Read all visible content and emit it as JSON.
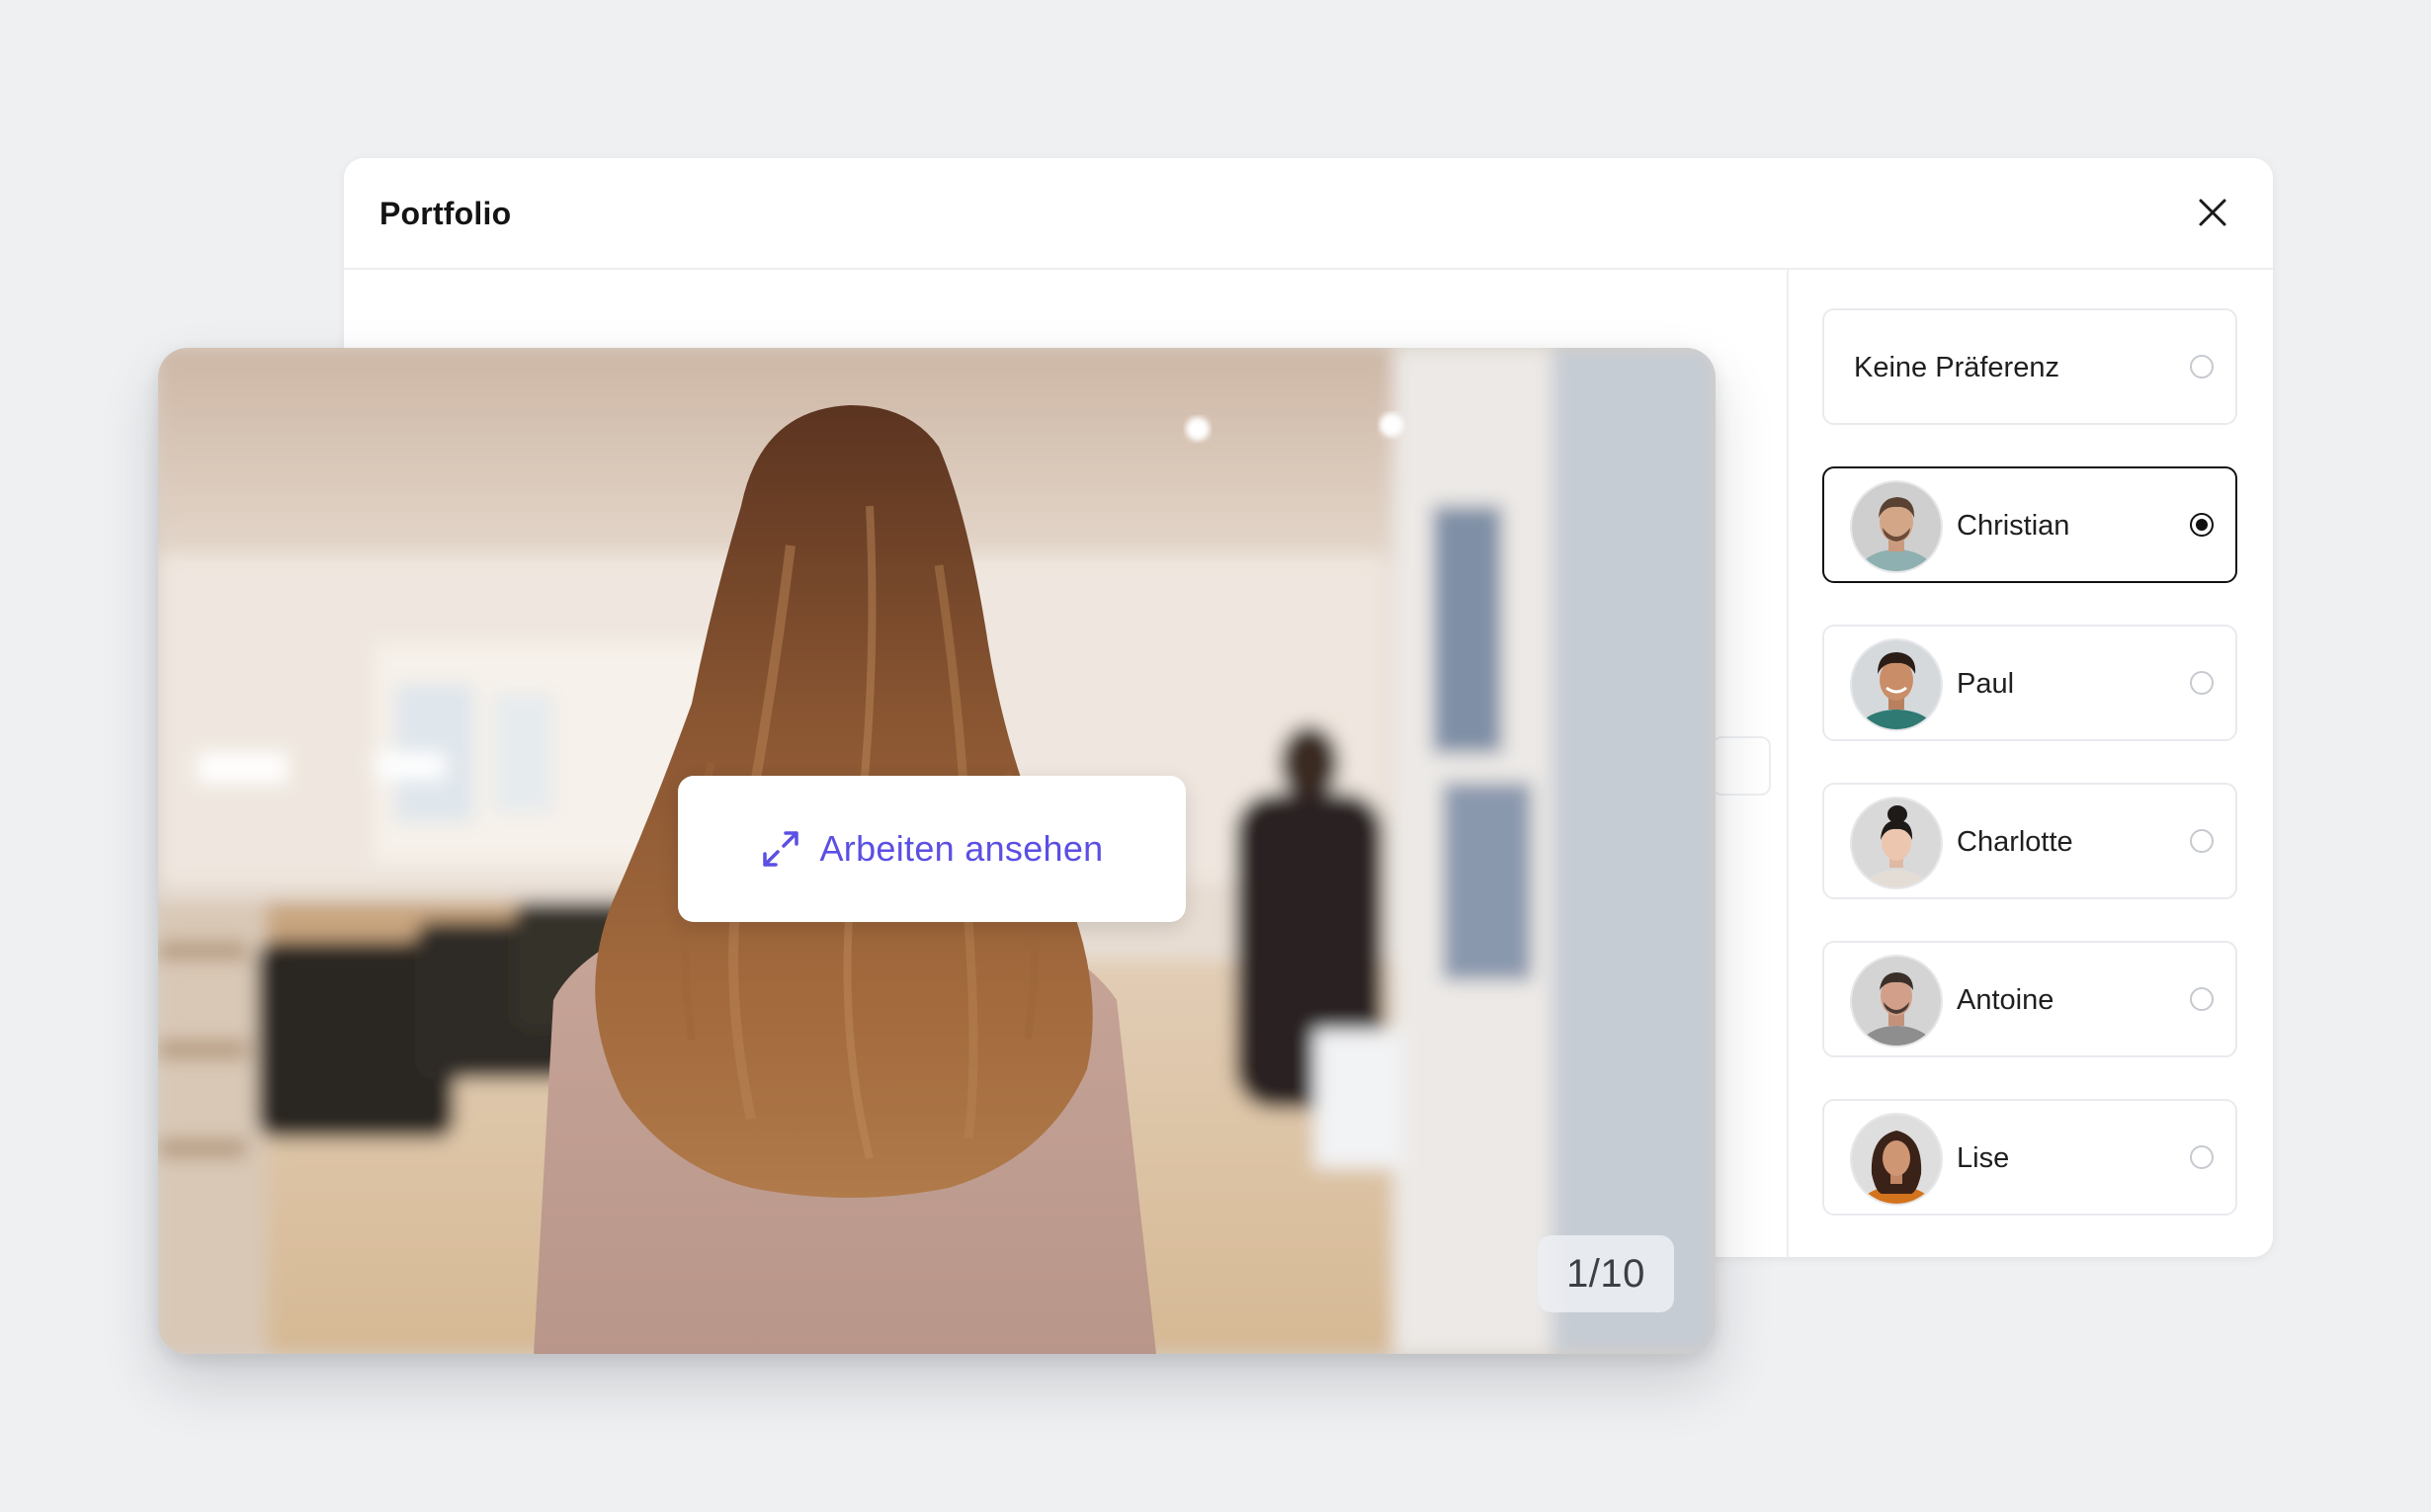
{
  "modal": {
    "title": "Portfolio"
  },
  "photo": {
    "action_label": "Arbeiten ansehen",
    "counter": "1/10"
  },
  "stylists": [
    {
      "name": "Keine Präferenz",
      "selected": false,
      "avatar": false
    },
    {
      "name": "Christian",
      "selected": true,
      "avatar": true
    },
    {
      "name": "Paul",
      "selected": false,
      "avatar": true
    },
    {
      "name": "Charlotte",
      "selected": false,
      "avatar": true
    },
    {
      "name": "Antoine",
      "selected": false,
      "avatar": true
    },
    {
      "name": "Lise",
      "selected": false,
      "avatar": true
    }
  ],
  "colors": {
    "accent": "#5b4fe4",
    "background": "#eff0f2",
    "selected_border": "#111111",
    "card_border": "#e8eaee"
  }
}
